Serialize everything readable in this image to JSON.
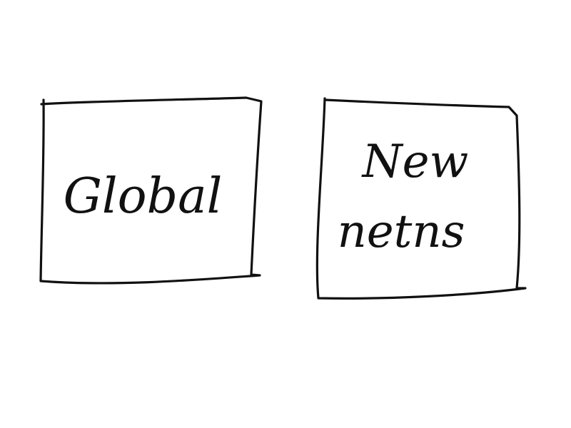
{
  "diagram": {
    "boxes": [
      {
        "id": "global",
        "lines": [
          "Global"
        ]
      },
      {
        "id": "new-items",
        "lines": [
          "New",
          "netns"
        ]
      }
    ],
    "colors": {
      "background": "#ffffff",
      "ink": "#111111"
    }
  }
}
